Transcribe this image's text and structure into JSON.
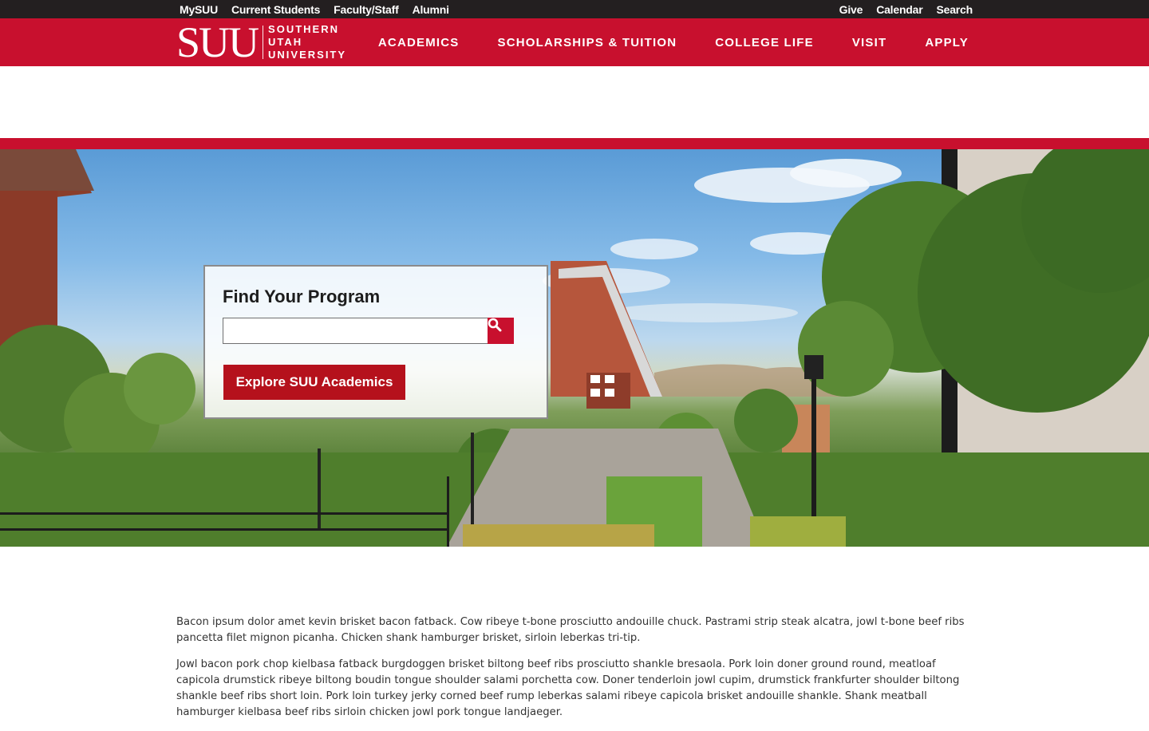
{
  "utility": {
    "left_links": [
      "MySUU",
      "Current Students",
      "Faculty/Staff",
      "Alumni"
    ],
    "right_links": [
      "Give",
      "Calendar",
      "Search"
    ]
  },
  "logo": {
    "mark": "SUU",
    "words": [
      "SOUTHERN",
      "UTAH",
      "UNIVERSITY"
    ]
  },
  "nav": {
    "items": [
      "ACADEMICS",
      "SCHOLARSHIPS & TUITION",
      "COLLEGE LIFE",
      "VISIT",
      "APPLY"
    ]
  },
  "find_program": {
    "title": "Find Your Program",
    "input_value": "",
    "search_icon": "search-icon",
    "explore_label": "Explore SUU Academics"
  },
  "content": {
    "paragraphs": [
      "Bacon ipsum dolor amet kevin brisket bacon fatback. Cow ribeye t-bone prosciutto andouille chuck. Pastrami strip steak alcatra, jowl t-bone beef ribs pancetta filet mignon picanha. Chicken shank hamburger brisket, sirloin leberkas tri-tip.",
      "Jowl bacon pork chop kielbasa fatback burgdoggen brisket biltong beef ribs prosciutto shankle bresaola. Pork loin doner ground round, meatloaf capicola drumstick ribeye biltong boudin tongue shoulder salami porchetta cow. Doner tenderloin jowl cupim, drumstick frankfurter shoulder biltong shankle beef ribs short loin. Pork loin turkey jerky corned beef rump leberkas salami ribeye capicola brisket andouille shankle. Shank meatball hamburger kielbasa beef ribs sirloin chicken jowl pork tongue landjaeger."
    ]
  },
  "colors": {
    "brand_red": "#c8102e",
    "utility_bar": "#231f20",
    "button_red": "#b5111c"
  }
}
